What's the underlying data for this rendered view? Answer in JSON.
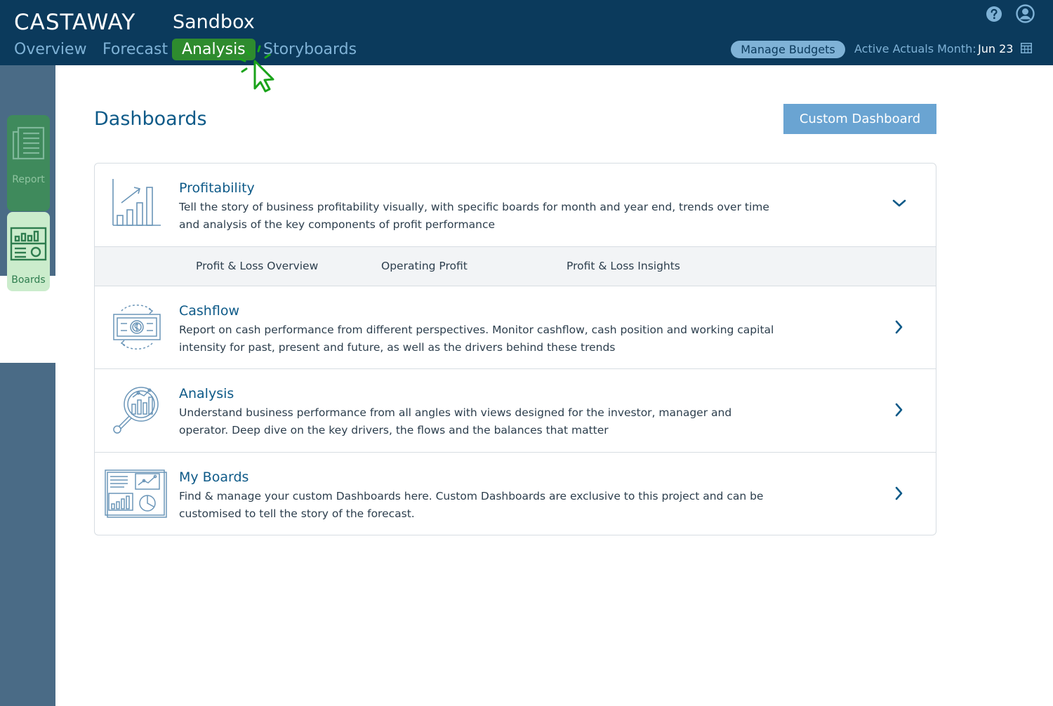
{
  "header": {
    "logo": "CASTAWAY",
    "project": "Sandbox",
    "nav": [
      {
        "label": "Overview",
        "active": false
      },
      {
        "label": "Forecast",
        "active": false
      },
      {
        "label": "Analysis",
        "active": true
      },
      {
        "label": "Storyboards",
        "active": false
      }
    ],
    "manage_budgets": "Manage Budgets",
    "actuals_label": "Active Actuals Month:",
    "actuals_value": "Jun 23",
    "icons": {
      "help": "help-circle-icon",
      "user": "user-account-icon",
      "calendar": "calendar-grid-icon",
      "cursor": "click-pointer-icon"
    }
  },
  "sidebar": {
    "items": [
      {
        "label": "Report",
        "icon": "report-document-icon"
      },
      {
        "label": "Boards",
        "icon": "boards-dashboard-icon"
      }
    ]
  },
  "main": {
    "title": "Dashboards",
    "custom_button": "Custom Dashboard",
    "sections": [
      {
        "title": "Profitability",
        "description": "Tell the story of business profitability visually, with specific boards for month and year end, trends over time and analysis of the key components of profit performance",
        "icon": "bar-chart-trend-icon",
        "expanded": true,
        "subtabs": [
          "Profit & Loss Overview",
          "Operating Profit",
          "Profit & Loss Insights"
        ]
      },
      {
        "title": "Cashflow",
        "description": "Report on cash performance from different perspectives. Monitor cashflow, cash position and working capital intensity for past, present and future, as well as the drivers behind these trends",
        "icon": "cash-cycle-icon",
        "expanded": false
      },
      {
        "title": "Analysis",
        "description": "Understand business performance from all angles with views designed for the investor, manager and operator. Deep dive on the key drivers, the flows and the balances that matter",
        "icon": "magnifier-chart-icon",
        "expanded": false
      },
      {
        "title": "My Boards",
        "description": "Find & manage your custom Dashboards here. Custom Dashboards are exclusive to this project and can be customised to tell the story of the forecast.",
        "icon": "custom-board-icon",
        "expanded": false
      }
    ]
  },
  "colors": {
    "header_bg": "#0b3a5c",
    "nav_text": "#7fb2d6",
    "active_tab": "#2e8b2e",
    "sidebar_bg": "#4a6b86",
    "title_blue": "#0e5a88",
    "button_blue": "#6aa4d2",
    "cursor_green": "#1aa31a"
  }
}
